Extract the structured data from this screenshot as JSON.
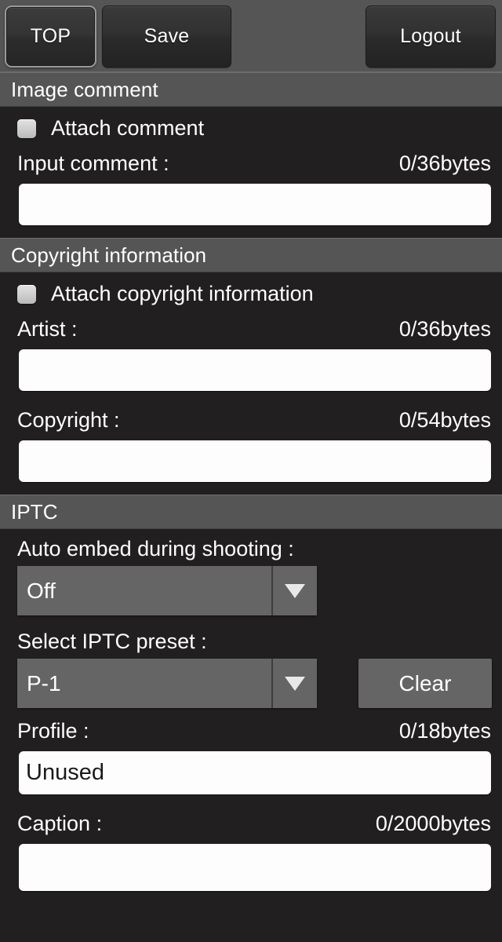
{
  "toolbar": {
    "top_label": "TOP",
    "save_label": "Save",
    "logout_label": "Logout"
  },
  "sections": {
    "image_comment": {
      "header": "Image comment",
      "attach_label": "Attach comment",
      "input_label": "Input comment :",
      "input_counter": "0/36bytes",
      "input_value": ""
    },
    "copyright": {
      "header": "Copyright information",
      "attach_label": "Attach copyright information",
      "artist_label": "Artist :",
      "artist_counter": "0/36bytes",
      "artist_value": "",
      "copyright_label": "Copyright :",
      "copyright_counter": "0/54bytes",
      "copyright_value": ""
    },
    "iptc": {
      "header": "IPTC",
      "auto_embed_label": "Auto embed during shooting :",
      "auto_embed_value": "Off",
      "preset_label": "Select IPTC preset :",
      "preset_value": "P-1",
      "clear_label": "Clear",
      "profile_label": "Profile :",
      "profile_counter": "0/18bytes",
      "profile_value": "Unused",
      "caption_label": "Caption :",
      "caption_counter": "0/2000bytes",
      "caption_value": ""
    }
  },
  "icons": {
    "dropdown_arrow": "chevron-down-icon",
    "checkbox": "checkbox-unchecked-icon"
  },
  "colors": {
    "background": "#211f1f",
    "header_bar": "#555556",
    "toolbar": "#555556",
    "control_gray": "#656566",
    "input_white": "#fdfdfd",
    "text": "#ffffff",
    "selected_border": "#9a9a9b"
  }
}
